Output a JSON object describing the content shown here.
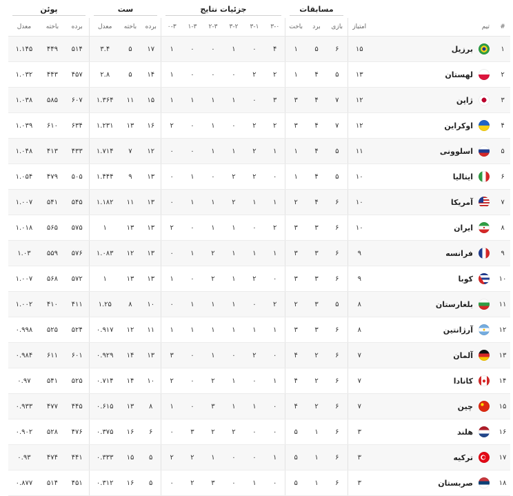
{
  "groups": {
    "matches": "مسابقات",
    "details": "جزئیات نتایج",
    "sets": "ست",
    "points": "پوئن"
  },
  "columns": {
    "rank": "#",
    "team": "تیم",
    "pts": "امتیاز",
    "played": "بازی",
    "won": "برد",
    "lost": "باخت",
    "r30": "۳-۰",
    "r31": "۳-۱",
    "r32": "۳-۲",
    "r23": "۲-۳",
    "r13": "۱-۳",
    "r03": "۰-۳",
    "sets_won": "برده",
    "sets_lost": "باخته",
    "sets_ratio": "معدل",
    "pts_won": "برده",
    "pts_lost": "باخته",
    "pts_ratio": "معدل"
  },
  "rows": [
    {
      "rank": "۱",
      "team": "برزیل",
      "flag": "br",
      "pts": "۱۵",
      "played": "۶",
      "won": "۵",
      "lost": "۱",
      "r30": "۴",
      "r31": "۰",
      "r32": "۱",
      "r23": "۰",
      "r13": "۰",
      "r03": "۱",
      "sw": "۱۷",
      "sl": "۵",
      "sr": "۳.۴",
      "pw": "۵۱۴",
      "pl": "۴۴۹",
      "pr": "۱.۱۴۵"
    },
    {
      "rank": "۲",
      "team": "لهستان",
      "flag": "pl",
      "pts": "۱۳",
      "played": "۵",
      "won": "۴",
      "lost": "۱",
      "r30": "۲",
      "r31": "۲",
      "r32": "۰",
      "r23": "۰",
      "r13": "۰",
      "r03": "۱",
      "sw": "۱۴",
      "sl": "۵",
      "sr": "۲.۸",
      "pw": "۴۵۷",
      "pl": "۴۴۳",
      "pr": "۱.۰۳۲"
    },
    {
      "rank": "۳",
      "team": "ژاپن",
      "flag": "jp",
      "pts": "۱۲",
      "played": "۷",
      "won": "۴",
      "lost": "۳",
      "r30": "۳",
      "r31": "۰",
      "r32": "۱",
      "r23": "۱",
      "r13": "۱",
      "r03": "۱",
      "sw": "۱۵",
      "sl": "۱۱",
      "sr": "۱.۳۶۴",
      "pw": "۶۰۷",
      "pl": "۵۸۵",
      "pr": "۱.۰۳۸"
    },
    {
      "rank": "۴",
      "team": "اوکراین",
      "flag": "ua",
      "pts": "۱۲",
      "played": "۷",
      "won": "۴",
      "lost": "۳",
      "r30": "۲",
      "r31": "۲",
      "r32": "۰",
      "r23": "۱",
      "r13": "۰",
      "r03": "۲",
      "sw": "۱۶",
      "sl": "۱۳",
      "sr": "۱.۲۳۱",
      "pw": "۶۳۴",
      "pl": "۶۱۰",
      "pr": "۱.۰۳۹"
    },
    {
      "rank": "۵",
      "team": "اسلوونی",
      "flag": "si",
      "pts": "۱۱",
      "played": "۵",
      "won": "۴",
      "lost": "۱",
      "r30": "۱",
      "r31": "۲",
      "r32": "۱",
      "r23": "۱",
      "r13": "۰",
      "r03": "۰",
      "sw": "۱۲",
      "sl": "۷",
      "sr": "۱.۷۱۴",
      "pw": "۴۳۳",
      "pl": "۴۱۳",
      "pr": "۱.۰۴۸"
    },
    {
      "rank": "۶",
      "team": "ایتالیا",
      "flag": "it",
      "pts": "۱۰",
      "played": "۵",
      "won": "۴",
      "lost": "۱",
      "r30": "۰",
      "r31": "۲",
      "r32": "۲",
      "r23": "۰",
      "r13": "۱",
      "r03": "۰",
      "sw": "۱۳",
      "sl": "۹",
      "sr": "۱.۴۴۴",
      "pw": "۵۰۵",
      "pl": "۴۷۹",
      "pr": "۱.۰۵۴"
    },
    {
      "rank": "۷",
      "team": "آمریکا",
      "flag": "us",
      "pts": "۱۰",
      "played": "۶",
      "won": "۴",
      "lost": "۲",
      "r30": "۱",
      "r31": "۱",
      "r32": "۲",
      "r23": "۱",
      "r13": "۱",
      "r03": "۰",
      "sw": "۱۳",
      "sl": "۱۱",
      "sr": "۱.۱۸۲",
      "pw": "۵۴۵",
      "pl": "۵۴۱",
      "pr": "۱.۰۰۷"
    },
    {
      "rank": "۸",
      "team": "ایران",
      "flag": "ir",
      "pts": "۱۰",
      "played": "۶",
      "won": "۳",
      "lost": "۳",
      "r30": "۲",
      "r31": "۰",
      "r32": "۱",
      "r23": "۱",
      "r13": "۰",
      "r03": "۲",
      "sw": "۱۳",
      "sl": "۱۳",
      "sr": "۱",
      "pw": "۵۷۵",
      "pl": "۵۶۵",
      "pr": "۱.۰۱۸"
    },
    {
      "rank": "۹",
      "team": "فرانسه",
      "flag": "fr",
      "pts": "۹",
      "played": "۶",
      "won": "۳",
      "lost": "۳",
      "r30": "۱",
      "r31": "۱",
      "r32": "۱",
      "r23": "۲",
      "r13": "۱",
      "r03": "۰",
      "sw": "۱۳",
      "sl": "۱۲",
      "sr": "۱.۰۸۳",
      "pw": "۵۷۶",
      "pl": "۵۵۹",
      "pr": "۱.۰۳"
    },
    {
      "rank": "۱۰",
      "team": "کوبا",
      "flag": "cu",
      "pts": "۹",
      "played": "۶",
      "won": "۳",
      "lost": "۳",
      "r30": "۰",
      "r31": "۲",
      "r32": "۱",
      "r23": "۲",
      "r13": "۰",
      "r03": "۱",
      "sw": "۱۳",
      "sl": "۱۳",
      "sr": "۱",
      "pw": "۵۷۲",
      "pl": "۵۶۸",
      "pr": "۱.۰۰۷"
    },
    {
      "rank": "۱۱",
      "team": "بلغارستان",
      "flag": "bg",
      "pts": "۸",
      "played": "۵",
      "won": "۳",
      "lost": "۲",
      "r30": "۲",
      "r31": "۰",
      "r32": "۱",
      "r23": "۱",
      "r13": "۱",
      "r03": "۰",
      "sw": "۱۰",
      "sl": "۸",
      "sr": "۱.۲۵",
      "pw": "۴۱۱",
      "pl": "۴۱۰",
      "pr": "۱.۰۰۲"
    },
    {
      "rank": "۱۲",
      "team": "آرژانتین",
      "flag": "ar",
      "pts": "۸",
      "played": "۶",
      "won": "۳",
      "lost": "۳",
      "r30": "۱",
      "r31": "۱",
      "r32": "۱",
      "r23": "۱",
      "r13": "۱",
      "r03": "۱",
      "sw": "۱۱",
      "sl": "۱۲",
      "sr": "۰.۹۱۷",
      "pw": "۵۲۴",
      "pl": "۵۲۵",
      "pr": "۰.۹۹۸"
    },
    {
      "rank": "۱۳",
      "team": "آلمان",
      "flag": "de",
      "pts": "۷",
      "played": "۶",
      "won": "۲",
      "lost": "۴",
      "r30": "۰",
      "r31": "۲",
      "r32": "۰",
      "r23": "۱",
      "r13": "۰",
      "r03": "۳",
      "sw": "۱۳",
      "sl": "۱۴",
      "sr": "۰.۹۲۹",
      "pw": "۶۰۱",
      "pl": "۶۱۱",
      "pr": "۰.۹۸۴"
    },
    {
      "rank": "۱۴",
      "team": "کانادا",
      "flag": "ca",
      "pts": "۷",
      "played": "۶",
      "won": "۲",
      "lost": "۴",
      "r30": "۱",
      "r31": "۰",
      "r32": "۱",
      "r23": "۲",
      "r13": "۰",
      "r03": "۲",
      "sw": "۱۰",
      "sl": "۱۴",
      "sr": "۰.۷۱۴",
      "pw": "۵۲۵",
      "pl": "۵۴۱",
      "pr": "۰.۹۷"
    },
    {
      "rank": "۱۵",
      "team": "چین",
      "flag": "cn",
      "pts": "۷",
      "played": "۶",
      "won": "۲",
      "lost": "۴",
      "r30": "۰",
      "r31": "۱",
      "r32": "۱",
      "r23": "۳",
      "r13": "۰",
      "r03": "۱",
      "sw": "۸",
      "sl": "۱۳",
      "sr": "۰.۶۱۵",
      "pw": "۴۴۵",
      "pl": "۴۷۷",
      "pr": "۰.۹۳۳"
    },
    {
      "rank": "۱۶",
      "team": "هلند",
      "flag": "nl",
      "pts": "۳",
      "played": "۶",
      "won": "۱",
      "lost": "۵",
      "r30": "۰",
      "r31": "۰",
      "r32": "۲",
      "r23": "۲",
      "r13": "۳",
      "r03": "۰",
      "sw": "۶",
      "sl": "۱۶",
      "sr": "۰.۳۷۵",
      "pw": "۴۷۶",
      "pl": "۵۲۸",
      "pr": "۰.۹۰۲"
    },
    {
      "rank": "۱۷",
      "team": "ترکیه",
      "flag": "tr",
      "pts": "۳",
      "played": "۶",
      "won": "۱",
      "lost": "۵",
      "r30": "۱",
      "r31": "۰",
      "r32": "۰",
      "r23": "۱",
      "r13": "۲",
      "r03": "۲",
      "sw": "۵",
      "sl": "۱۵",
      "sr": "۰.۳۳۳",
      "pw": "۴۴۱",
      "pl": "۴۷۴",
      "pr": "۰.۹۳"
    },
    {
      "rank": "۱۸",
      "team": "صربستان",
      "flag": "rs",
      "pts": "۳",
      "played": "۶",
      "won": "۱",
      "lost": "۵",
      "r30": "۰",
      "r31": "۱",
      "r32": "۰",
      "r23": "۳",
      "r13": "۲",
      "r03": "۰",
      "sw": "۵",
      "sl": "۱۶",
      "sr": "۰.۳۱۲",
      "pw": "۴۵۱",
      "pl": "۵۱۴",
      "pr": "۰.۸۷۷"
    }
  ]
}
